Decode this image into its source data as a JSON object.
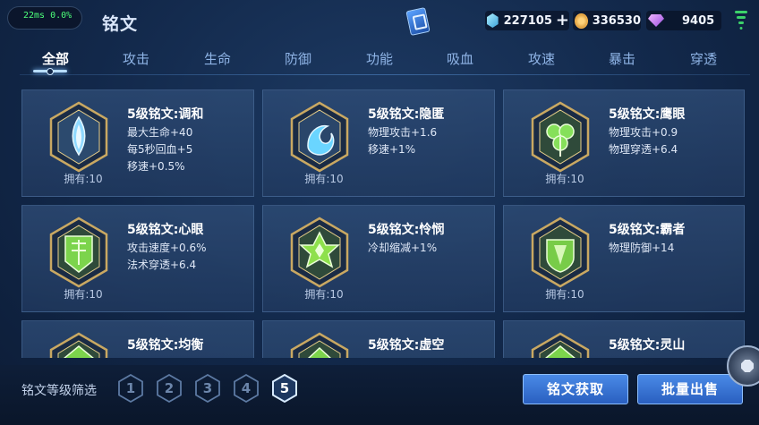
{
  "perf": {
    "latency": "22ms",
    "loss": "0.0%"
  },
  "title": "铭文",
  "currencies": {
    "gem": "227105",
    "gold": "336530",
    "diamond": "9405",
    "plus": "+"
  },
  "tabs": [
    "全部",
    "攻击",
    "生命",
    "防御",
    "功能",
    "吸血",
    "攻速",
    "暴击",
    "穿透"
  ],
  "active_tab": "全部",
  "cards": [
    {
      "name": "5级铭文:调和",
      "attrs": [
        "最大生命+40",
        "每5秒回血+5",
        "移速+0.5%"
      ],
      "owned": "拥有:10",
      "icon": "blue-flame-emblem-icon",
      "color": "#8fd9ff"
    },
    {
      "name": "5级铭文:隐匿",
      "attrs": [
        "物理攻击+1.6",
        "移速+1%"
      ],
      "owned": "拥有:10",
      "icon": "blue-swirl-emblem-icon",
      "color": "#6ad5ff"
    },
    {
      "name": "5级铭文:鹰眼",
      "attrs": [
        "物理攻击+0.9",
        "物理穿透+6.4"
      ],
      "owned": "拥有:10",
      "icon": "green-clover-emblem-icon",
      "color": "#86e05a"
    },
    {
      "name": "5级铭文:心眼",
      "attrs": [
        "攻击速度+0.6%",
        "法术穿透+6.4"
      ],
      "owned": "拥有:10",
      "icon": "green-shield-emblem-icon",
      "color": "#7cd44c"
    },
    {
      "name": "5级铭文:怜悯",
      "attrs": [
        "冷却缩减+1%"
      ],
      "owned": "拥有:10",
      "icon": "green-star-emblem-icon",
      "color": "#8ee04c"
    },
    {
      "name": "5级铭文:霸者",
      "attrs": [
        "物理防御+14"
      ],
      "owned": "拥有:10",
      "icon": "green-crest-emblem-icon",
      "color": "#78cc48"
    },
    {
      "name": "5级铭文:均衡",
      "attrs": [],
      "owned": "",
      "icon": "green-emblem-icon",
      "color": "#7cd44c"
    },
    {
      "name": "5级铭文:虚空",
      "attrs": [],
      "owned": "",
      "icon": "green-emblem-icon",
      "color": "#7cd44c"
    },
    {
      "name": "5级铭文:灵山",
      "attrs": [],
      "owned": "",
      "icon": "green-emblem-icon",
      "color": "#7cd44c"
    }
  ],
  "filter": {
    "label": "铭文等级筛选",
    "levels": [
      "1",
      "2",
      "3",
      "4",
      "5"
    ],
    "selected": "5"
  },
  "buttons": {
    "get": "铭文获取",
    "sell": "批量出售"
  }
}
